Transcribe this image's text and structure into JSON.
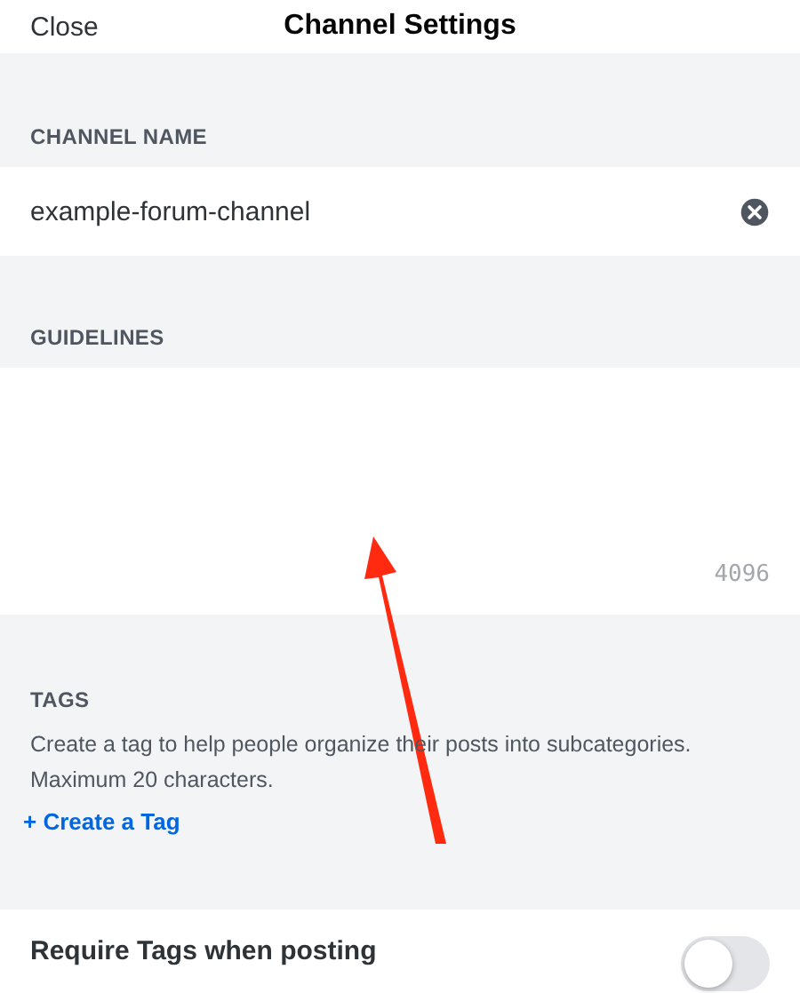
{
  "header": {
    "close": "Close",
    "title": "Channel Settings"
  },
  "channel_name": {
    "label": "CHANNEL NAME",
    "value": "example-forum-channel"
  },
  "guidelines": {
    "label": "GUIDELINES",
    "counter": "4096"
  },
  "tags": {
    "label": "TAGS",
    "description": "Create a tag to help people organize their posts into subcategories. Maximum 20 characters.",
    "link": "+ Create a Tag"
  },
  "require_tags": {
    "label": "Require Tags when posting",
    "on": false
  },
  "annotation": {
    "kind": "arrow"
  }
}
